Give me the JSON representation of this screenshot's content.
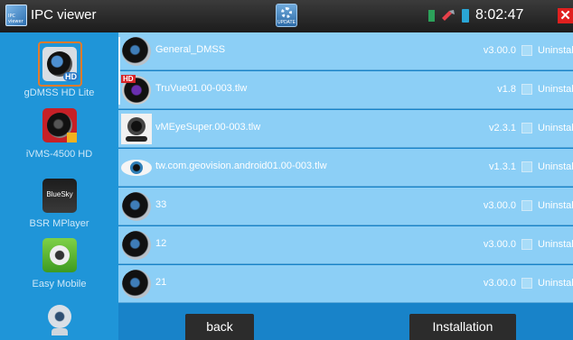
{
  "titlebar": {
    "title": "IPC viewer",
    "app_icon_label": "IPC viewer",
    "update_label": "UPDATE",
    "time": "8:02:47",
    "close_glyph": "✕"
  },
  "sidebar": {
    "items": [
      {
        "label": "gDMSS HD Lite",
        "icon": "gdmss-hd-icon",
        "selected": true
      },
      {
        "label": "iVMS-4500 HD",
        "icon": "ivms-icon",
        "selected": false
      },
      {
        "label": "BSR MPlayer",
        "icon": "bluesky-icon",
        "icon_text": "BlueSky",
        "selected": false
      },
      {
        "label": "Easy Mobile",
        "icon": "easy-mobile-icon",
        "selected": false
      },
      {
        "label": "",
        "icon": "webcam-icon",
        "selected": false
      }
    ]
  },
  "apps": [
    {
      "name": "General_DMSS",
      "version": "v3.00.0",
      "status": "Uninstalled",
      "icon": "dmss-icon"
    },
    {
      "name": "TruVue01.00-003.tlw",
      "version": "v1.8",
      "status": "Uninstalled",
      "icon": "truvue-icon"
    },
    {
      "name": "vMEyeSuper.00-003.tlw",
      "version": "v2.3.1",
      "status": "Uninstalled",
      "icon": "vmeye-icon"
    },
    {
      "name": "tw.com.geovision.android01.00-003.tlw",
      "version": "v1.3.1",
      "status": "Uninstalled",
      "icon": "geovision-eye-icon"
    },
    {
      "name": "33",
      "version": "v3.00.0",
      "status": "Uninstalled",
      "icon": "dmss-icon"
    },
    {
      "name": "12",
      "version": "v3.00.0",
      "status": "Uninstalled",
      "icon": "dmss-icon"
    },
    {
      "name": "21",
      "version": "v3.00.0",
      "status": "Uninstalled",
      "icon": "dmss-icon"
    }
  ],
  "footer": {
    "back_label": "back",
    "install_label": "Installation"
  },
  "colors": {
    "sidebar_bg": "#1f95d8",
    "row_bg": "#8ccff6",
    "selection_frame": "#e57b2a",
    "close_red": "#e0201f"
  }
}
